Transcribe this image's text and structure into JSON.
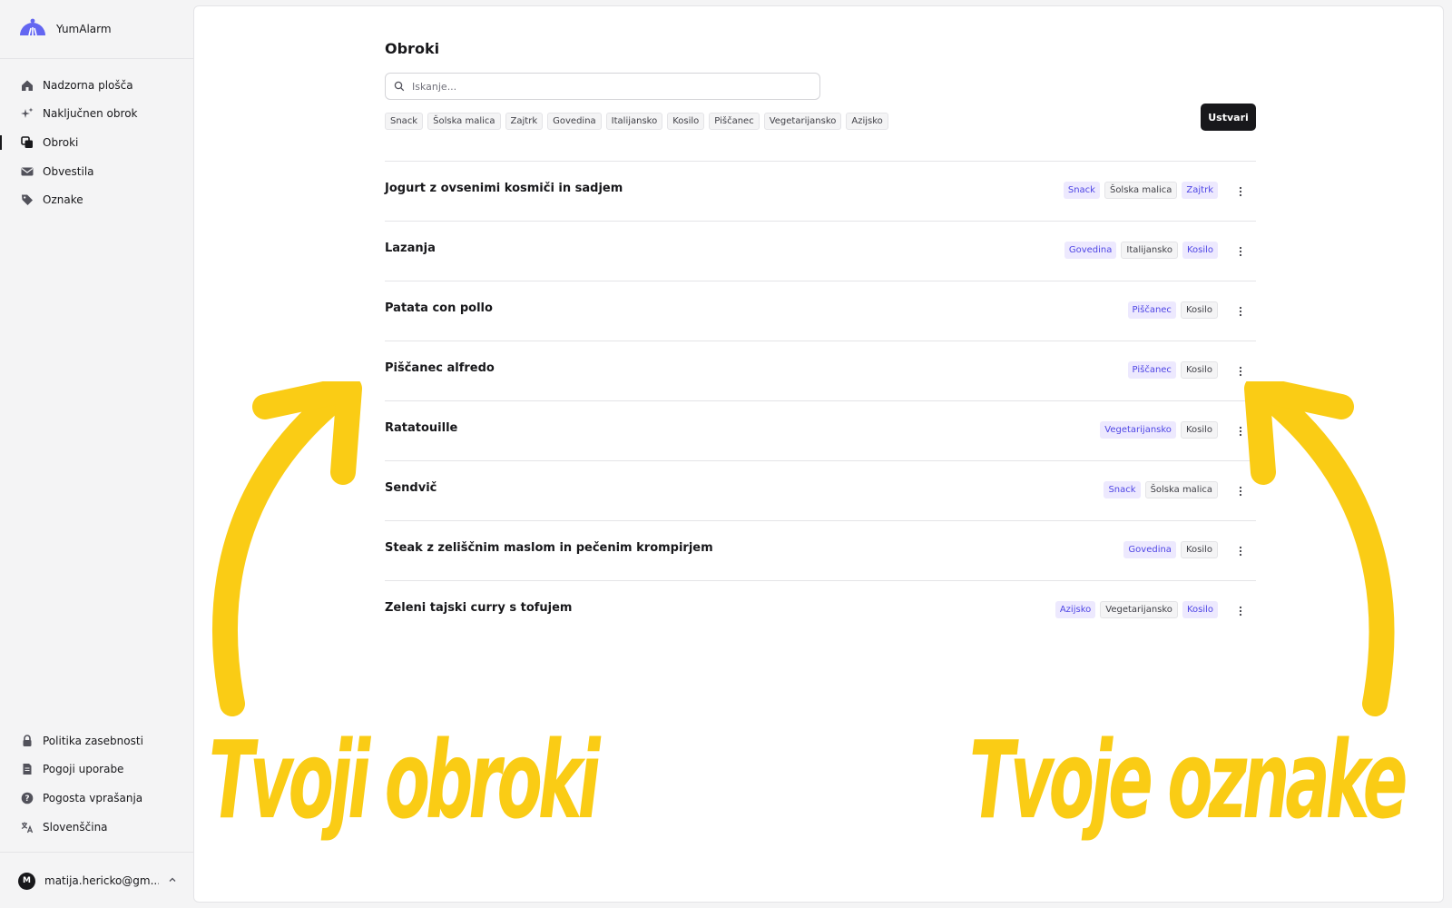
{
  "app": {
    "name": "YumAlarm"
  },
  "sidebar": {
    "nav": [
      {
        "label": "Nadzorna plošča",
        "icon": "home-icon",
        "active": false
      },
      {
        "label": "Naključnen obrok",
        "icon": "sparkles-icon",
        "active": false
      },
      {
        "label": "Obroki",
        "icon": "copy-icon",
        "active": true
      },
      {
        "label": "Obvestila",
        "icon": "envelope-icon",
        "active": false
      },
      {
        "label": "Oznake",
        "icon": "tag-icon",
        "active": false
      }
    ],
    "footer_nav": [
      {
        "label": "Politika zasebnosti",
        "icon": "lock-icon"
      },
      {
        "label": "Pogoji uporabe",
        "icon": "document-icon"
      },
      {
        "label": "Pogosta vprašanja",
        "icon": "question-icon"
      },
      {
        "label": "Slovenščina",
        "icon": "translate-icon"
      }
    ],
    "user": {
      "initial": "M",
      "email": "matija.hericko@gm..."
    }
  },
  "main": {
    "title": "Obroki",
    "search": {
      "placeholder": "Iskanje...",
      "value": ""
    },
    "filter_tags": [
      "Snack",
      "Šolska malica",
      "Zajtrk",
      "Govedina",
      "Italijansko",
      "Kosilo",
      "Piščanec",
      "Vegetarijansko",
      "Azijsko"
    ],
    "create_label": "Ustvari",
    "meals": [
      {
        "name": "Jogurt z ovsenimi kosmiči in sadjem",
        "tags": [
          {
            "label": "Snack",
            "style": "accent"
          },
          {
            "label": "Šolska malica",
            "style": "neutral"
          },
          {
            "label": "Zajtrk",
            "style": "accent"
          }
        ]
      },
      {
        "name": "Lazanja",
        "tags": [
          {
            "label": "Govedina",
            "style": "accent"
          },
          {
            "label": "Italijansko",
            "style": "neutral"
          },
          {
            "label": "Kosilo",
            "style": "accent"
          }
        ]
      },
      {
        "name": "Patata con pollo",
        "tags": [
          {
            "label": "Piščanec",
            "style": "accent"
          },
          {
            "label": "Kosilo",
            "style": "neutral"
          }
        ]
      },
      {
        "name": "Piščanec alfredo",
        "tags": [
          {
            "label": "Piščanec",
            "style": "accent"
          },
          {
            "label": "Kosilo",
            "style": "neutral"
          }
        ]
      },
      {
        "name": "Ratatouille",
        "tags": [
          {
            "label": "Vegetarijansko",
            "style": "accent"
          },
          {
            "label": "Kosilo",
            "style": "neutral"
          }
        ]
      },
      {
        "name": "Sendvič",
        "tags": [
          {
            "label": "Snack",
            "style": "accent"
          },
          {
            "label": "Šolska malica",
            "style": "neutral"
          }
        ]
      },
      {
        "name": "Steak z zeliščnim maslom in pečenim krompirjem",
        "tags": [
          {
            "label": "Govedina",
            "style": "accent"
          },
          {
            "label": "Kosilo",
            "style": "neutral"
          }
        ]
      },
      {
        "name": "Zeleni tajski curry s tofujem",
        "tags": [
          {
            "label": "Azijsko",
            "style": "accent"
          },
          {
            "label": "Vegetarijansko",
            "style": "neutral"
          },
          {
            "label": "Kosilo",
            "style": "accent"
          }
        ]
      }
    ]
  },
  "annotations": {
    "left": "Tvoji obroki",
    "right": "Tvoje oznake",
    "color": "#facc15"
  },
  "colors": {
    "accent_bg": "#ede9fe",
    "accent_text": "#4f46e5",
    "primary_button": "#18181b",
    "brand": "#6366f1"
  }
}
